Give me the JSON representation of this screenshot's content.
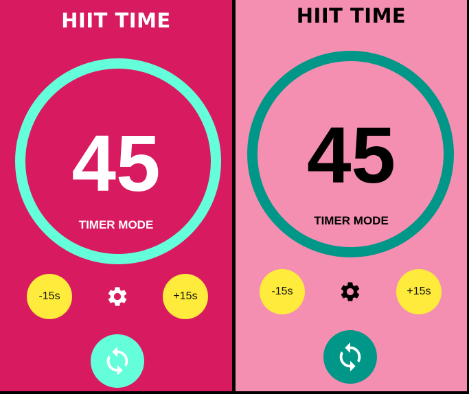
{
  "screens": [
    {
      "title": "HIIT TIME",
      "timer_value": "45",
      "mode_label": "TIMER MODE",
      "minus_label": "-15s",
      "plus_label": "+15s",
      "settings_icon": "gear-icon",
      "refresh_icon": "refresh-icon",
      "colors": {
        "background": "#D81B60",
        "ring": "#64FFDA",
        "text": "#FFFFFF",
        "buttons": "#FFEB3B",
        "refresh_button": "#64FFDA",
        "refresh_icon": "#FFFFFF"
      }
    },
    {
      "title": "HIIT TIME",
      "timer_value": "45",
      "mode_label": "TIMER MODE",
      "minus_label": "-15s",
      "plus_label": "+15s",
      "settings_icon": "gear-icon",
      "refresh_icon": "refresh-icon",
      "colors": {
        "background": "#F48FB1",
        "ring": "#009688",
        "text": "#000000",
        "buttons": "#FFEB3B",
        "refresh_button": "#009688",
        "refresh_icon": "#FFFFFF"
      }
    }
  ]
}
